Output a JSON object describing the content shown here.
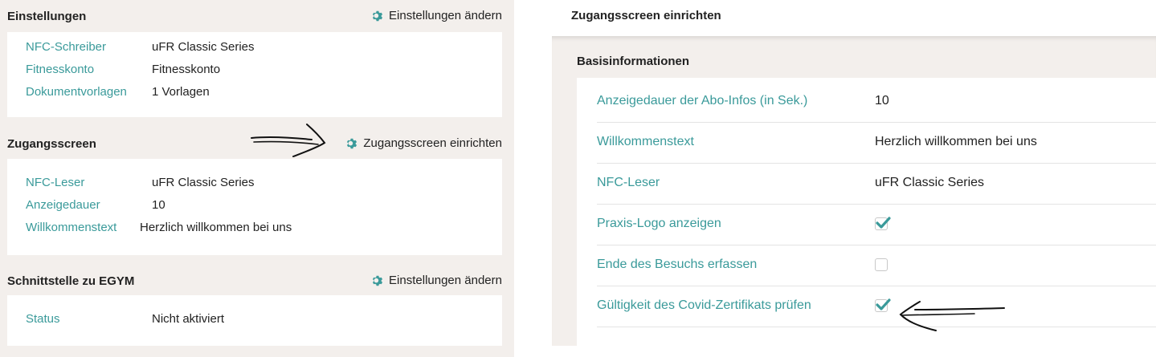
{
  "left": {
    "sections": [
      {
        "title": "Einstellungen",
        "action": "Einstellungen ändern",
        "rows": [
          {
            "label": "NFC-Schreiber",
            "value": "uFR Classic Series"
          },
          {
            "label": "Fitnesskonto",
            "value": "Fitnesskonto"
          },
          {
            "label": "Dokumentvorlagen",
            "value": "1 Vorlagen"
          }
        ]
      },
      {
        "title": "Zugangsscreen",
        "action": "Zugangsscreen einrichten",
        "rows": [
          {
            "label": "NFC-Leser",
            "value": "uFR Classic Series"
          },
          {
            "label": "Anzeigedauer",
            "value": "10"
          },
          {
            "label": "Willkommenstext",
            "value": "Herzlich willkommen bei uns"
          }
        ]
      },
      {
        "title": "Schnittstelle zu EGYM",
        "action": "Einstellungen ändern",
        "rows": [
          {
            "label": "Status",
            "value": "Nicht aktiviert"
          }
        ]
      }
    ]
  },
  "right": {
    "header_title": "Zugangsscreen einrichten",
    "section_title": "Basisinformationen",
    "fields": [
      {
        "label": "Anzeigedauer der Abo-Infos (in Sek.)",
        "value": "10"
      },
      {
        "label": "Willkommenstext",
        "value": "Herzlich willkommen bei uns"
      },
      {
        "label": "NFC-Leser",
        "value": "uFR Classic Series"
      },
      {
        "label": "Praxis-Logo anzeigen",
        "checked": true
      },
      {
        "label": "Ende des Besuchs erfassen",
        "checked": false
      },
      {
        "label": "Gültigkeit des Covid-Zertifikats prüfen",
        "checked": true
      }
    ]
  },
  "colors": {
    "accent": "#3a9a9a",
    "panel_bg": "#f3efec",
    "card_bg": "#ffffff",
    "text": "#222222"
  },
  "icons": {
    "settings": "gear-icon",
    "checkbox": "checkmark-icon",
    "annotation": "hand-drawn-arrow"
  }
}
